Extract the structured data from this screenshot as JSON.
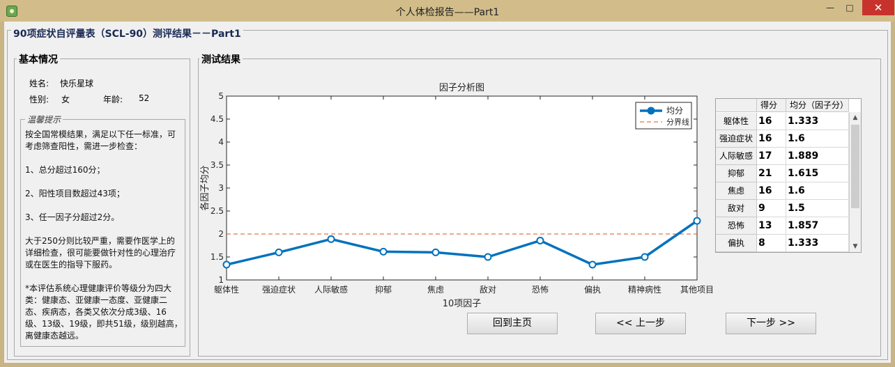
{
  "window": {
    "title": "个人体检报告——Part1"
  },
  "main": {
    "title": "90项症状自评量表（SCL-90）测评结果－－Part1"
  },
  "basic": {
    "title": "基本情况",
    "name_label": "姓名:",
    "name_value": "快乐星球",
    "gender_label": "性别:",
    "gender_value": "女",
    "age_label": "年龄:",
    "age_value": "52",
    "tips_title": "温馨提示",
    "tips_text": "按全国常模结果，满足以下任一标准，可考虑筛查阳性，需进一步检查：\n\n1、总分超过160分；\n\n2、阳性项目数超过43项；\n\n3、任一因子分超过2分。\n\n大于250分则比较严重，需要作医学上的详细检查，很可能要做针对性的心理治疗或在医生的指导下服药。\n\n*本评估系统心理健康评价等级分为四大类：健康态、亚健康一态度、亚健康二态、疾病态，各类又依次分成3级、16级、13级、19级，即共51级，级别越高，离健康态越远。"
  },
  "result": {
    "title": "测试结果"
  },
  "chart_data": {
    "type": "line",
    "title": "因子分析图",
    "xlabel": "10项因子",
    "ylabel": "各因子均分",
    "categories": [
      "躯体性",
      "强迫症状",
      "人际敏感",
      "抑郁",
      "焦虑",
      "敌对",
      "恐怖",
      "偏执",
      "精神病性",
      "其他项目"
    ],
    "series": [
      {
        "name": "均分",
        "values": [
          1.333,
          1.6,
          1.889,
          1.615,
          1.6,
          1.5,
          1.857,
          1.333,
          1.5,
          2.286
        ],
        "color": "#0072bd"
      },
      {
        "name": "分界线",
        "values": [
          2,
          2,
          2,
          2,
          2,
          2,
          2,
          2,
          2,
          2
        ],
        "color": "#d95319"
      }
    ],
    "ylim": [
      1,
      5
    ],
    "yticks": [
      "1",
      "1.5",
      "2",
      "2.5",
      "3",
      "3.5",
      "4",
      "4.5",
      "5"
    ],
    "grid": false,
    "legend_position": "top-right"
  },
  "table": {
    "headers": [
      "",
      "得分",
      "均分（因子分）"
    ],
    "rows": [
      {
        "factor": "躯体性",
        "score": "16",
        "mean": "1.333"
      },
      {
        "factor": "强迫症状",
        "score": "16",
        "mean": "1.6"
      },
      {
        "factor": "人际敏感",
        "score": "17",
        "mean": "1.889"
      },
      {
        "factor": "抑郁",
        "score": "21",
        "mean": "1.615"
      },
      {
        "factor": "焦虑",
        "score": "16",
        "mean": "1.6"
      },
      {
        "factor": "敌对",
        "score": "9",
        "mean": "1.5"
      },
      {
        "factor": "恐怖",
        "score": "13",
        "mean": "1.857"
      },
      {
        "factor": "偏执",
        "score": "8",
        "mean": "1.333"
      }
    ]
  },
  "buttons": {
    "home": "回到主页",
    "prev": "<< 上一步",
    "next": "下一步 >>"
  }
}
